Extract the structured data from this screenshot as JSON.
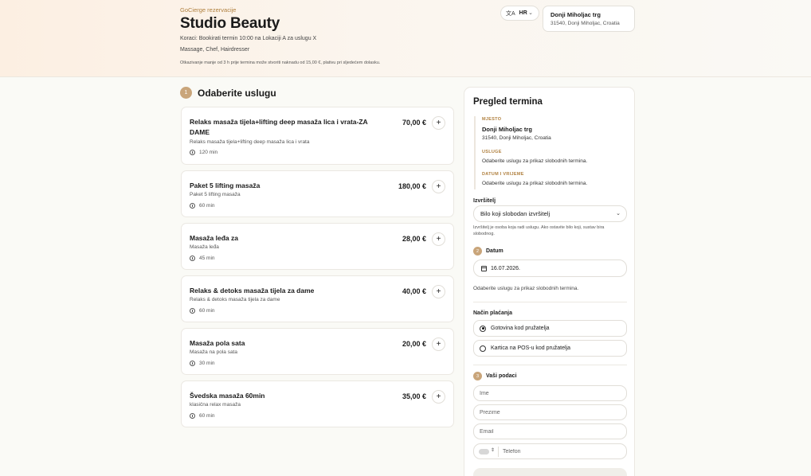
{
  "header": {
    "kicker": "GoCierge rezervacije",
    "title": "Studio Beauty",
    "steps": "Koraci: Bookirati termin 10:00 na Lokaciji A za uslugu X",
    "categories": "Massage, Chef, Hairdresser",
    "notice": "Otkazivanje manje od 3 h prije termina može stvoriti naknadu od 15,00 €, plativu pri sljedećem dolasku."
  },
  "language": {
    "code": "HR",
    "icon": "translate-icon"
  },
  "location": {
    "name": "Donji Miholjac trg",
    "address": "31540, Donji Miholjac, Croatia"
  },
  "services_section": {
    "number": "1",
    "title": "Odaberite uslugu"
  },
  "services": [
    {
      "name": "Relaks masaža tijela+lifting deep masaža lica i vrata-ZA DAME",
      "desc": "Relaks masaža tijela+lifting deep masaža lica i vrata",
      "duration": "120 min",
      "price": "70,00 €"
    },
    {
      "name": "Paket 5 lifting masaža",
      "desc": "Paket 5 lifting masaža",
      "duration": "60 min",
      "price": "180,00 €"
    },
    {
      "name": "Masaža leđa za",
      "desc": "Masaža leđa",
      "duration": "45 min",
      "price": "28,00 €"
    },
    {
      "name": "Relaks & detoks masaža tijela za dame",
      "desc": "Relaks & detoks masaža tijela za dame",
      "duration": "60 min",
      "price": "40,00 €"
    },
    {
      "name": "Masaža pola sata",
      "desc": "Masaža na pola sata",
      "duration": "30 min",
      "price": "20,00 €"
    },
    {
      "name": "Švedska masaža 60min",
      "desc": "klasična relax masaža",
      "duration": "60 min",
      "price": "35,00 €"
    }
  ],
  "summary": {
    "title": "Pregled termina",
    "place_label": "MJESTO",
    "place_name": "Donji Miholjac trg",
    "place_address": "31540, Donji Miholjac, Croatia",
    "services_label": "USLUGE",
    "services_value": "Odaberite uslugu za prikaz slobodnih termina.",
    "datetime_label": "DATUM I VRIJEME",
    "datetime_value": "Odaberite uslugu za prikaz slobodnih termina."
  },
  "performer": {
    "label": "Izvršitelj",
    "selected": "Bilo koji slobodan izvršitelj",
    "hint": "Izvršitelj je osoba koja radi uslugu. Ako ostavite bilo koji, sustav bira slobodnog."
  },
  "date_step": {
    "number": "2",
    "label": "Datum",
    "value": "16.07.2026.",
    "message": "Odaberite uslugu za prikaz slobodnih termina."
  },
  "payment": {
    "label": "Način plaćanja",
    "options": [
      {
        "label": "Gotovina kod pružatelja",
        "selected": true
      },
      {
        "label": "Kartica na POS-u kod pružatelja",
        "selected": false
      }
    ]
  },
  "details_step": {
    "number": "3",
    "label": "Vaši podaci",
    "first_name_placeholder": "Ime",
    "last_name_placeholder": "Prezime",
    "email_placeholder": "Email",
    "phone_placeholder": "Telefon"
  },
  "colors": {
    "accent": "#c9a57a",
    "accent_text": "#b0803f"
  }
}
